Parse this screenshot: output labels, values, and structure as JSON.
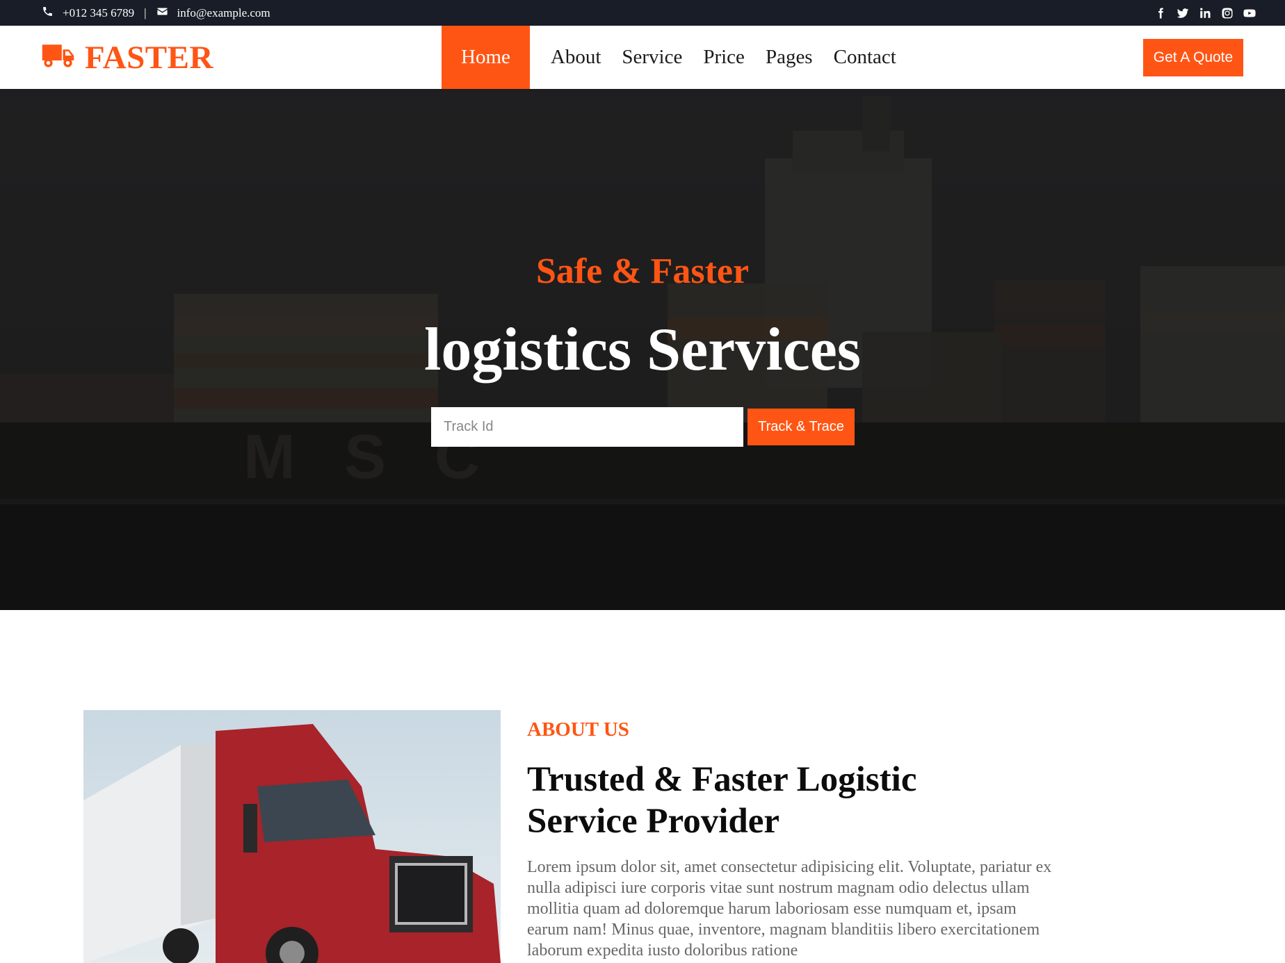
{
  "topbar": {
    "phone": "+012 345 6789",
    "separator": "|",
    "email": "info@example.com",
    "social": [
      "facebook-icon",
      "twitter-icon",
      "linkedin-icon",
      "instagram-icon",
      "youtube-icon"
    ]
  },
  "brand": {
    "name": "FASTER",
    "icon": "truck-icon"
  },
  "nav": {
    "items": [
      {
        "label": "Home",
        "active": true
      },
      {
        "label": "About"
      },
      {
        "label": "Service"
      },
      {
        "label": "Price"
      },
      {
        "label": "Pages"
      },
      {
        "label": "Contact"
      }
    ],
    "cta": "Get A Quote"
  },
  "hero": {
    "kicker": "Safe & Faster",
    "headline": "logistics Services",
    "track_placeholder": "Track Id",
    "track_button": "Track & Trace"
  },
  "about": {
    "kicker": "ABOUT US",
    "title": "Trusted & Faster Logistic Service Provider",
    "text": "Lorem ipsum dolor sit, amet consectetur adipisicing elit. Voluptate, pariatur ex nulla adipisci iure corporis vitae sunt nostrum magnam odio delectus ullam mollitia quam ad doloremque harum laboriosam esse numquam et, ipsam earum nam! Minus quae, inventore, magnam blanditiis libero exercitationem laborum expedita iusto doloribus ratione"
  },
  "colors": {
    "accent": "#ff5514",
    "topbar": "#181d27",
    "heading": "#0c0c0c",
    "body_text": "#666666"
  }
}
